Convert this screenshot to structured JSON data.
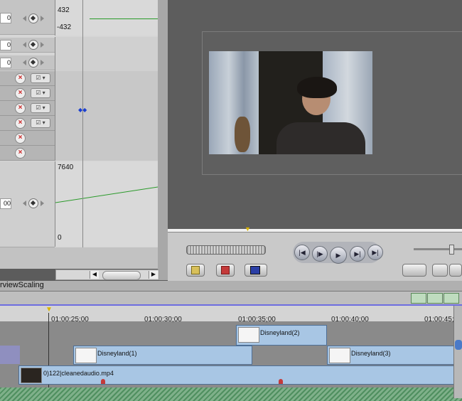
{
  "left_panel": {
    "rows_top": [
      {
        "value": "0",
        "graph_top": "432",
        "graph_bottom": "-432"
      },
      {
        "value": "0"
      },
      {
        "value": "0"
      }
    ],
    "bottom_row": {
      "value": "00",
      "graph_top": "7640",
      "graph_bottom": "0"
    }
  },
  "viewer": {
    "playhead_label": "",
    "controls": [
      "go-to-start",
      "play-in-to-out",
      "play",
      "play-around",
      "go-to-end"
    ]
  },
  "timeline": {
    "tab_label": "rviewScaling",
    "ruler": [
      "01:00:25;00",
      "01:00:30;00",
      "01:00:35;00",
      "01:00:40;00",
      "01:00:45;"
    ],
    "clips": {
      "v3": "Disneyland(2)",
      "v2a": "Disneyland(1)",
      "v2b": "Disneyland(3)",
      "v1": "0)122|cleanedaudio.mp4"
    }
  },
  "colors": {
    "clip_blue": "#a8c6e4",
    "keyframe_line": "#2a9a2a",
    "marker_red": "#c43a3a"
  }
}
